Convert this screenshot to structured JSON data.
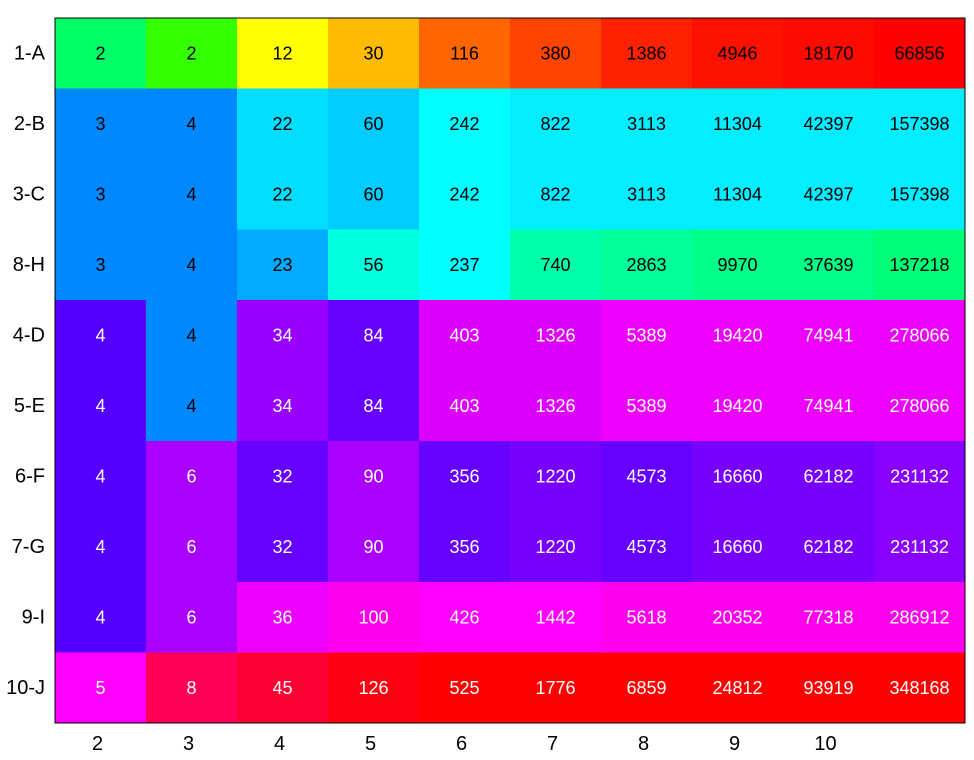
{
  "chart_data": {
    "type": "heatmap",
    "title": "",
    "xlabel": "",
    "ylabel": "",
    "grid": false,
    "legend": "none",
    "row_labels": [
      "1-A",
      "2-B",
      "3-C",
      "8-H",
      "4-D",
      "5-E",
      "6-F",
      "7-G",
      "9-I",
      "10-J"
    ],
    "x_tick_labels": [
      "2",
      "3",
      "4",
      "5",
      "6",
      "7",
      "8",
      "9",
      "10"
    ],
    "values": [
      [
        2,
        2,
        12,
        30,
        116,
        380,
        1386,
        4946,
        18170,
        66856
      ],
      [
        3,
        4,
        22,
        60,
        242,
        822,
        3113,
        11304,
        42397,
        157398
      ],
      [
        3,
        4,
        22,
        60,
        242,
        822,
        3113,
        11304,
        42397,
        157398
      ],
      [
        3,
        4,
        23,
        56,
        237,
        740,
        2863,
        9970,
        37639,
        137218
      ],
      [
        4,
        4,
        34,
        84,
        403,
        1326,
        5389,
        19420,
        74941,
        278066
      ],
      [
        4,
        4,
        34,
        84,
        403,
        1326,
        5389,
        19420,
        74941,
        278066
      ],
      [
        4,
        6,
        32,
        90,
        356,
        1220,
        4573,
        16660,
        62182,
        231132
      ],
      [
        4,
        6,
        32,
        90,
        356,
        1220,
        4573,
        16660,
        62182,
        231132
      ],
      [
        4,
        6,
        36,
        100,
        426,
        1442,
        5618,
        20352,
        77318,
        286912
      ],
      [
        5,
        8,
        45,
        126,
        525,
        1776,
        6859,
        24812,
        93919,
        348168
      ]
    ],
    "cell_colors": [
      [
        "#00ff66",
        "#33ff00",
        "#ffff00",
        "#ffbb00",
        "#ff6600",
        "#ff4400",
        "#ff2200",
        "#ff1100",
        "#ff0a00",
        "#ff0000"
      ],
      [
        "#0088ff",
        "#0088ff",
        "#00ddff",
        "#00ccff",
        "#00ffff",
        "#00eeff",
        "#00eeff",
        "#00eeff",
        "#00eeff",
        "#00eeff"
      ],
      [
        "#0088ff",
        "#0088ff",
        "#00ddff",
        "#00ccff",
        "#00ffff",
        "#00eeff",
        "#00eeff",
        "#00eeff",
        "#00eeff",
        "#00eeff"
      ],
      [
        "#0088ff",
        "#0088ff",
        "#00aaff",
        "#00ffdd",
        "#00ffff",
        "#00ffaa",
        "#00ff99",
        "#00ff88",
        "#00ff88",
        "#00ff77"
      ],
      [
        "#5500ff",
        "#0088ff",
        "#9900ff",
        "#6600ff",
        "#dd00ff",
        "#dd00ff",
        "#ee00ff",
        "#ee00ff",
        "#ee00ff",
        "#ee00ff"
      ],
      [
        "#5500ff",
        "#0088ff",
        "#9900ff",
        "#6600ff",
        "#dd00ff",
        "#dd00ff",
        "#ee00ff",
        "#ee00ff",
        "#ee00ff",
        "#ee00ff"
      ],
      [
        "#5500ff",
        "#aa00ff",
        "#6600ff",
        "#aa00ff",
        "#6600ff",
        "#7700ff",
        "#6600ff",
        "#7700ff",
        "#7700ff",
        "#8800ff"
      ],
      [
        "#5500ff",
        "#aa00ff",
        "#6600ff",
        "#aa00ff",
        "#6600ff",
        "#7700ff",
        "#6600ff",
        "#7700ff",
        "#7700ff",
        "#8800ff"
      ],
      [
        "#5500ff",
        "#aa00ff",
        "#ee00ff",
        "#ff00ee",
        "#ff00ff",
        "#ff00ff",
        "#ff00ee",
        "#ff00ee",
        "#ff00ee",
        "#ff00ee"
      ],
      [
        "#ff00ff",
        "#ff0055",
        "#ff0033",
        "#ff0011",
        "#ff0000",
        "#ff0000",
        "#ff0000",
        "#ff0000",
        "#ff0000",
        "#ff0000"
      ]
    ],
    "text_colors": [
      [
        "#000000",
        "#000000",
        "#000000",
        "#000000",
        "#000000",
        "#000000",
        "#000000",
        "#000000",
        "#000000",
        "#000000"
      ],
      [
        "#000000",
        "#000000",
        "#000000",
        "#000000",
        "#000000",
        "#000000",
        "#000000",
        "#000000",
        "#000000",
        "#000000"
      ],
      [
        "#000000",
        "#000000",
        "#000000",
        "#000000",
        "#000000",
        "#000000",
        "#000000",
        "#000000",
        "#000000",
        "#000000"
      ],
      [
        "#000000",
        "#000000",
        "#000000",
        "#000000",
        "#000000",
        "#000000",
        "#000000",
        "#000000",
        "#000000",
        "#000000"
      ],
      [
        "#ffffff",
        "#000000",
        "#ffffff",
        "#ffffff",
        "#ffffff",
        "#ffffff",
        "#ffffff",
        "#ffffff",
        "#ffffff",
        "#ffffff"
      ],
      [
        "#ffffff",
        "#000000",
        "#ffffff",
        "#ffffff",
        "#ffffff",
        "#ffffff",
        "#ffffff",
        "#ffffff",
        "#ffffff",
        "#ffffff"
      ],
      [
        "#ffffff",
        "#ffffff",
        "#ffffff",
        "#ffffff",
        "#ffffff",
        "#ffffff",
        "#ffffff",
        "#ffffff",
        "#ffffff",
        "#ffffff"
      ],
      [
        "#ffffff",
        "#ffffff",
        "#ffffff",
        "#ffffff",
        "#ffffff",
        "#ffffff",
        "#ffffff",
        "#ffffff",
        "#ffffff",
        "#ffffff"
      ],
      [
        "#ffffff",
        "#ffffff",
        "#ffffff",
        "#ffffff",
        "#ffffff",
        "#ffffff",
        "#ffffff",
        "#ffffff",
        "#ffffff",
        "#ffffff"
      ],
      [
        "#ffffff",
        "#ffffff",
        "#ffffff",
        "#ffffff",
        "#ffffff",
        "#ffffff",
        "#ffffff",
        "#ffffff",
        "#ffffff",
        "#ffffff"
      ]
    ]
  }
}
